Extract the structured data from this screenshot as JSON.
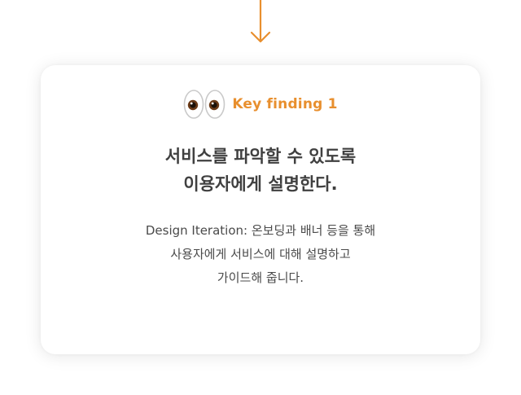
{
  "finding": {
    "label": "Key finding 1",
    "icon": "eyes-icon"
  },
  "headline": {
    "line1": "서비스를 파악할 수 있도록",
    "line2": "이용자에게 설명한다."
  },
  "body": {
    "line1": "Design Iteration: 온보딩과 배너 등을 통해",
    "line2": "사용자에게 서비스에 대해 설명하고",
    "line3": "가이드해 줍니다."
  },
  "colors": {
    "accent": "#e88f2e",
    "heading": "#404040",
    "text": "#4a4a4a",
    "card_bg": "#ffffff"
  },
  "decor": {
    "arrow_icon": "arrow-down-icon"
  }
}
